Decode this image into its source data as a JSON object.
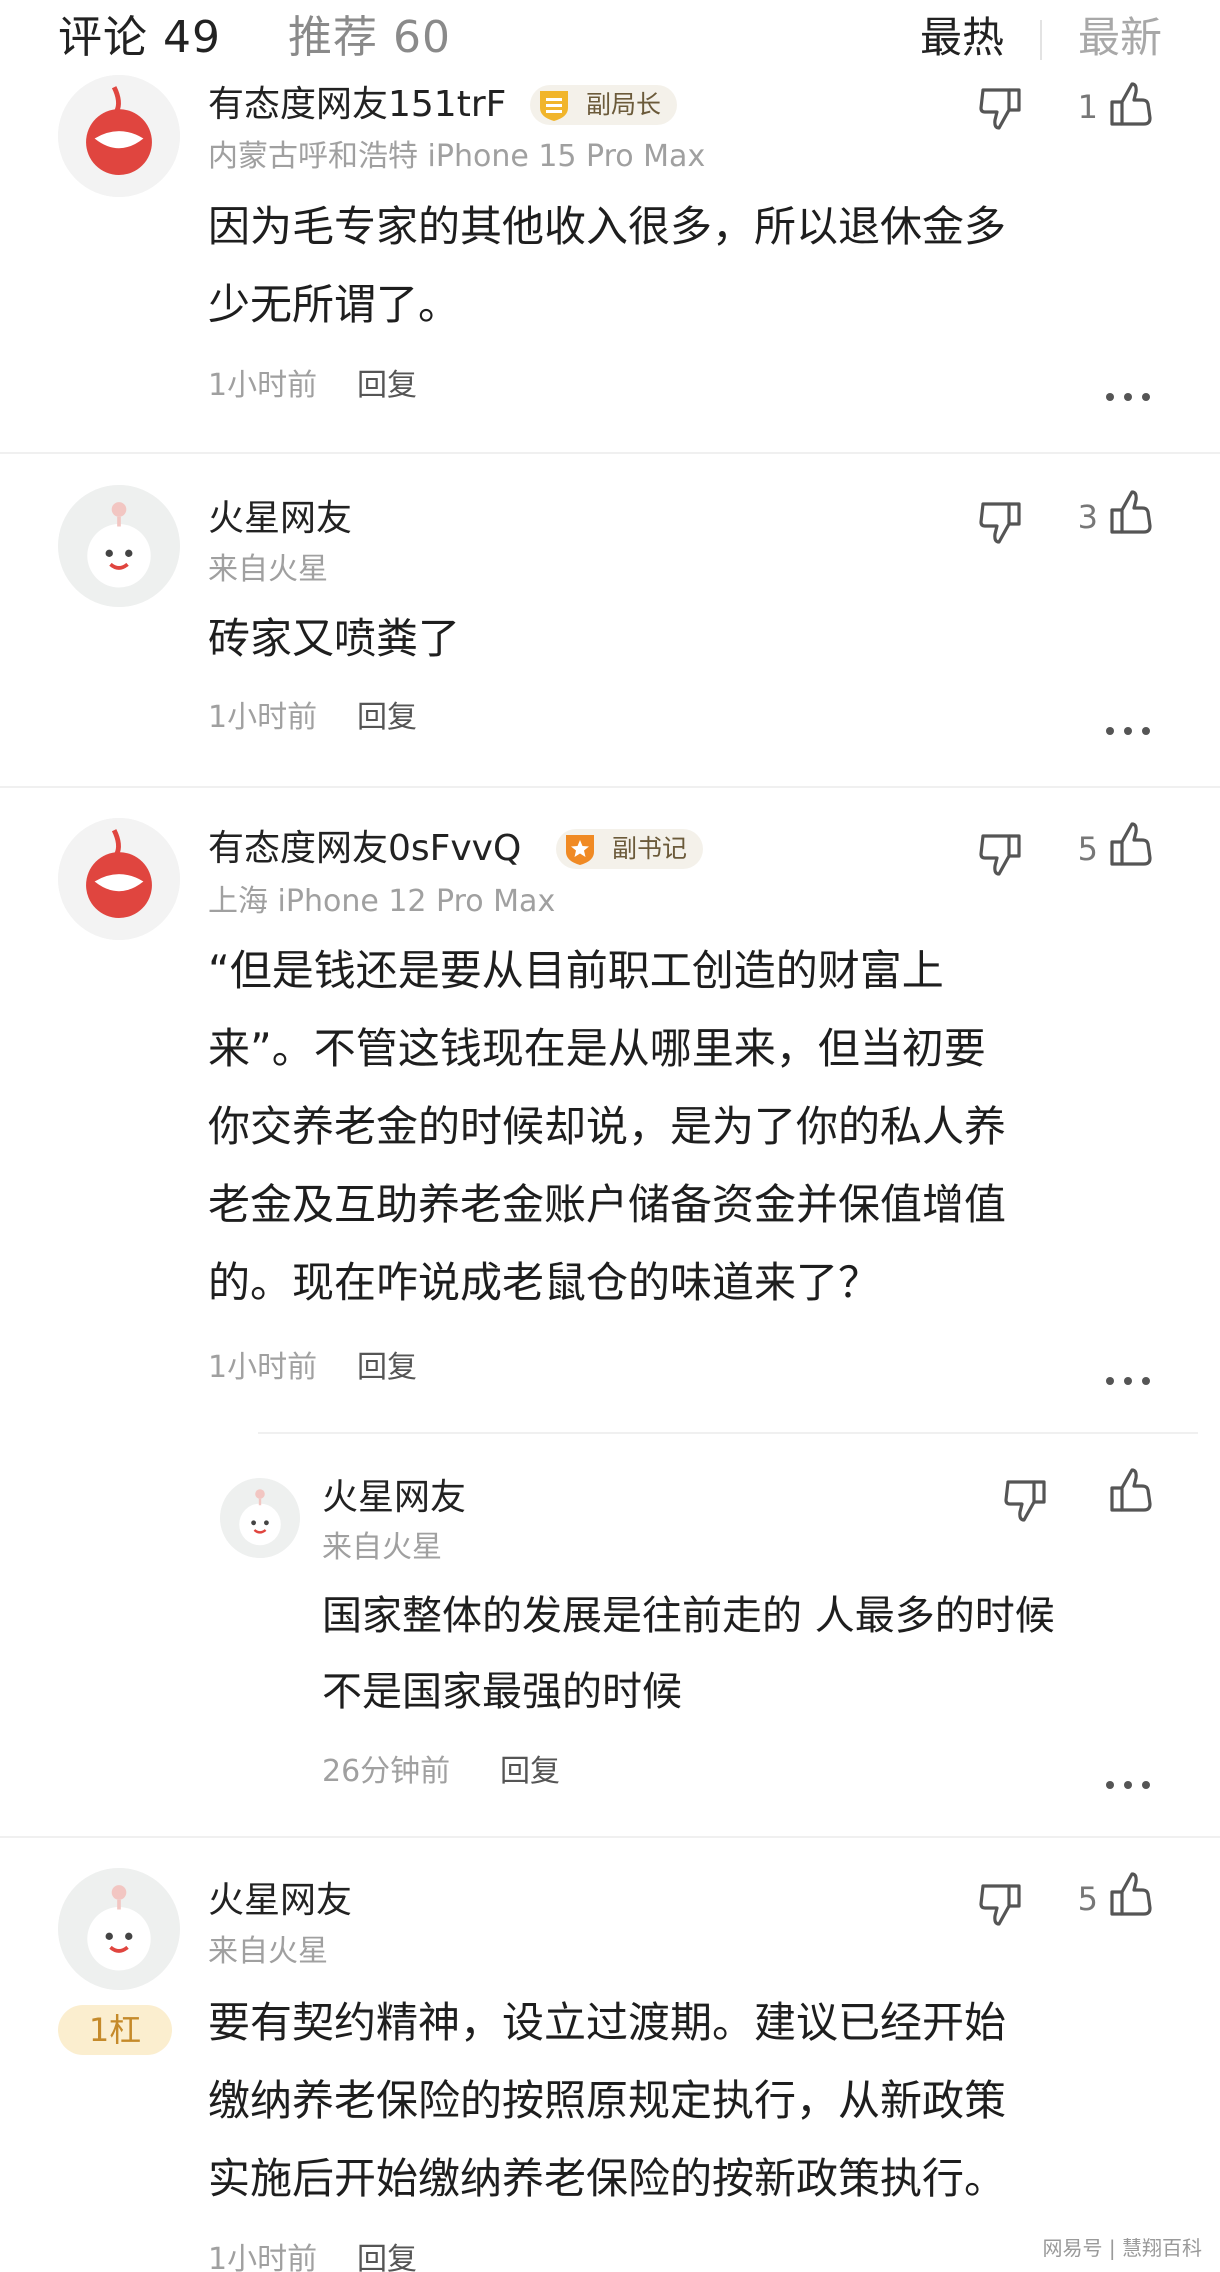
{
  "header": {
    "comments_tab": "评论 49",
    "recommend_tab": "推荐 60",
    "sort_hot": "最热",
    "sort_new": "最新"
  },
  "comments": [
    {
      "username": "有态度网友151trF",
      "badge": "副局长",
      "location": "内蒙古呼和浩特 iPhone 15 Pro Max",
      "body_lines": [
        "因为毛专家的其他收入很多，所以退休金多",
        "少无所谓了。"
      ],
      "time": "1小时前",
      "reply": "回复",
      "likes": "1"
    },
    {
      "username": "火星网友",
      "location": "来自火星",
      "body_lines": [
        "砖家又喷粪了"
      ],
      "time": "1小时前",
      "reply": "回复",
      "likes": "3"
    },
    {
      "username": "有态度网友0sFvvQ",
      "badge": "副书记",
      "location": "上海 iPhone 12 Pro Max",
      "body_lines": [
        "“但是钱还是要从目前职工创造的财富上",
        "来”。不管这钱现在是从哪里来，但当初要",
        "你交养老金的时候却说，是为了你的私人养",
        "老金及互助养老金账户储备资金并保值增值",
        "的。现在咋说成老鼠仓的味道来了？"
      ],
      "time": "1小时前",
      "reply": "回复",
      "likes": "5",
      "replies": [
        {
          "username": "火星网友",
          "location": "来自火星",
          "body_lines": [
            "国家整体的发展是往前走的 人最多的时候",
            "不是国家最强的时候"
          ],
          "time": "26分钟前",
          "reply": "回复"
        }
      ]
    },
    {
      "username": "火星网友",
      "location": "来自火星",
      "rank_badge": "1杠",
      "body_lines": [
        "要有契约精神，设立过渡期。建议已经开始",
        "缴纳养老保险的按照原规定执行，从新政策",
        "实施后开始缴纳养老保险的按新政策执行。"
      ],
      "time": "1小时前",
      "reply": "回复",
      "likes": "5"
    }
  ],
  "icons": {
    "dislike": "thumbs-down-icon",
    "like": "thumbs-up-icon",
    "more": "more-dots-icon",
    "avatar_default": "mars-avatar-icon",
    "avatar_brand": "netease-avatar-icon"
  },
  "colors": {
    "accent": "#e0453f",
    "muted_text": "#a0a0a0",
    "badge_bg": "#f4f1ea",
    "rank_bg": "#fbeecf",
    "rank_text": "#c58a2a"
  },
  "watermark": "网易号 | 慧翔百科"
}
